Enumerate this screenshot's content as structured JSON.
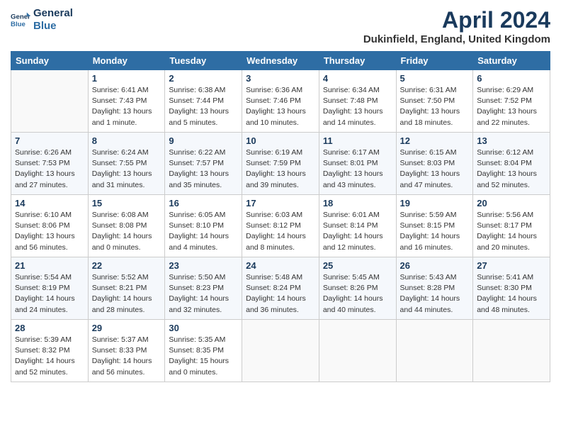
{
  "logo": {
    "line1": "General",
    "line2": "Blue"
  },
  "title": "April 2024",
  "location": "Dukinfield, England, United Kingdom",
  "weekdays": [
    "Sunday",
    "Monday",
    "Tuesday",
    "Wednesday",
    "Thursday",
    "Friday",
    "Saturday"
  ],
  "weeks": [
    [
      {
        "day": "",
        "info": ""
      },
      {
        "day": "1",
        "info": "Sunrise: 6:41 AM\nSunset: 7:43 PM\nDaylight: 13 hours\nand 1 minute."
      },
      {
        "day": "2",
        "info": "Sunrise: 6:38 AM\nSunset: 7:44 PM\nDaylight: 13 hours\nand 5 minutes."
      },
      {
        "day": "3",
        "info": "Sunrise: 6:36 AM\nSunset: 7:46 PM\nDaylight: 13 hours\nand 10 minutes."
      },
      {
        "day": "4",
        "info": "Sunrise: 6:34 AM\nSunset: 7:48 PM\nDaylight: 13 hours\nand 14 minutes."
      },
      {
        "day": "5",
        "info": "Sunrise: 6:31 AM\nSunset: 7:50 PM\nDaylight: 13 hours\nand 18 minutes."
      },
      {
        "day": "6",
        "info": "Sunrise: 6:29 AM\nSunset: 7:52 PM\nDaylight: 13 hours\nand 22 minutes."
      }
    ],
    [
      {
        "day": "7",
        "info": "Sunrise: 6:26 AM\nSunset: 7:53 PM\nDaylight: 13 hours\nand 27 minutes."
      },
      {
        "day": "8",
        "info": "Sunrise: 6:24 AM\nSunset: 7:55 PM\nDaylight: 13 hours\nand 31 minutes."
      },
      {
        "day": "9",
        "info": "Sunrise: 6:22 AM\nSunset: 7:57 PM\nDaylight: 13 hours\nand 35 minutes."
      },
      {
        "day": "10",
        "info": "Sunrise: 6:19 AM\nSunset: 7:59 PM\nDaylight: 13 hours\nand 39 minutes."
      },
      {
        "day": "11",
        "info": "Sunrise: 6:17 AM\nSunset: 8:01 PM\nDaylight: 13 hours\nand 43 minutes."
      },
      {
        "day": "12",
        "info": "Sunrise: 6:15 AM\nSunset: 8:03 PM\nDaylight: 13 hours\nand 47 minutes."
      },
      {
        "day": "13",
        "info": "Sunrise: 6:12 AM\nSunset: 8:04 PM\nDaylight: 13 hours\nand 52 minutes."
      }
    ],
    [
      {
        "day": "14",
        "info": "Sunrise: 6:10 AM\nSunset: 8:06 PM\nDaylight: 13 hours\nand 56 minutes."
      },
      {
        "day": "15",
        "info": "Sunrise: 6:08 AM\nSunset: 8:08 PM\nDaylight: 14 hours\nand 0 minutes."
      },
      {
        "day": "16",
        "info": "Sunrise: 6:05 AM\nSunset: 8:10 PM\nDaylight: 14 hours\nand 4 minutes."
      },
      {
        "day": "17",
        "info": "Sunrise: 6:03 AM\nSunset: 8:12 PM\nDaylight: 14 hours\nand 8 minutes."
      },
      {
        "day": "18",
        "info": "Sunrise: 6:01 AM\nSunset: 8:14 PM\nDaylight: 14 hours\nand 12 minutes."
      },
      {
        "day": "19",
        "info": "Sunrise: 5:59 AM\nSunset: 8:15 PM\nDaylight: 14 hours\nand 16 minutes."
      },
      {
        "day": "20",
        "info": "Sunrise: 5:56 AM\nSunset: 8:17 PM\nDaylight: 14 hours\nand 20 minutes."
      }
    ],
    [
      {
        "day": "21",
        "info": "Sunrise: 5:54 AM\nSunset: 8:19 PM\nDaylight: 14 hours\nand 24 minutes."
      },
      {
        "day": "22",
        "info": "Sunrise: 5:52 AM\nSunset: 8:21 PM\nDaylight: 14 hours\nand 28 minutes."
      },
      {
        "day": "23",
        "info": "Sunrise: 5:50 AM\nSunset: 8:23 PM\nDaylight: 14 hours\nand 32 minutes."
      },
      {
        "day": "24",
        "info": "Sunrise: 5:48 AM\nSunset: 8:24 PM\nDaylight: 14 hours\nand 36 minutes."
      },
      {
        "day": "25",
        "info": "Sunrise: 5:45 AM\nSunset: 8:26 PM\nDaylight: 14 hours\nand 40 minutes."
      },
      {
        "day": "26",
        "info": "Sunrise: 5:43 AM\nSunset: 8:28 PM\nDaylight: 14 hours\nand 44 minutes."
      },
      {
        "day": "27",
        "info": "Sunrise: 5:41 AM\nSunset: 8:30 PM\nDaylight: 14 hours\nand 48 minutes."
      }
    ],
    [
      {
        "day": "28",
        "info": "Sunrise: 5:39 AM\nSunset: 8:32 PM\nDaylight: 14 hours\nand 52 minutes."
      },
      {
        "day": "29",
        "info": "Sunrise: 5:37 AM\nSunset: 8:33 PM\nDaylight: 14 hours\nand 56 minutes."
      },
      {
        "day": "30",
        "info": "Sunrise: 5:35 AM\nSunset: 8:35 PM\nDaylight: 15 hours\nand 0 minutes."
      },
      {
        "day": "",
        "info": ""
      },
      {
        "day": "",
        "info": ""
      },
      {
        "day": "",
        "info": ""
      },
      {
        "day": "",
        "info": ""
      }
    ]
  ]
}
